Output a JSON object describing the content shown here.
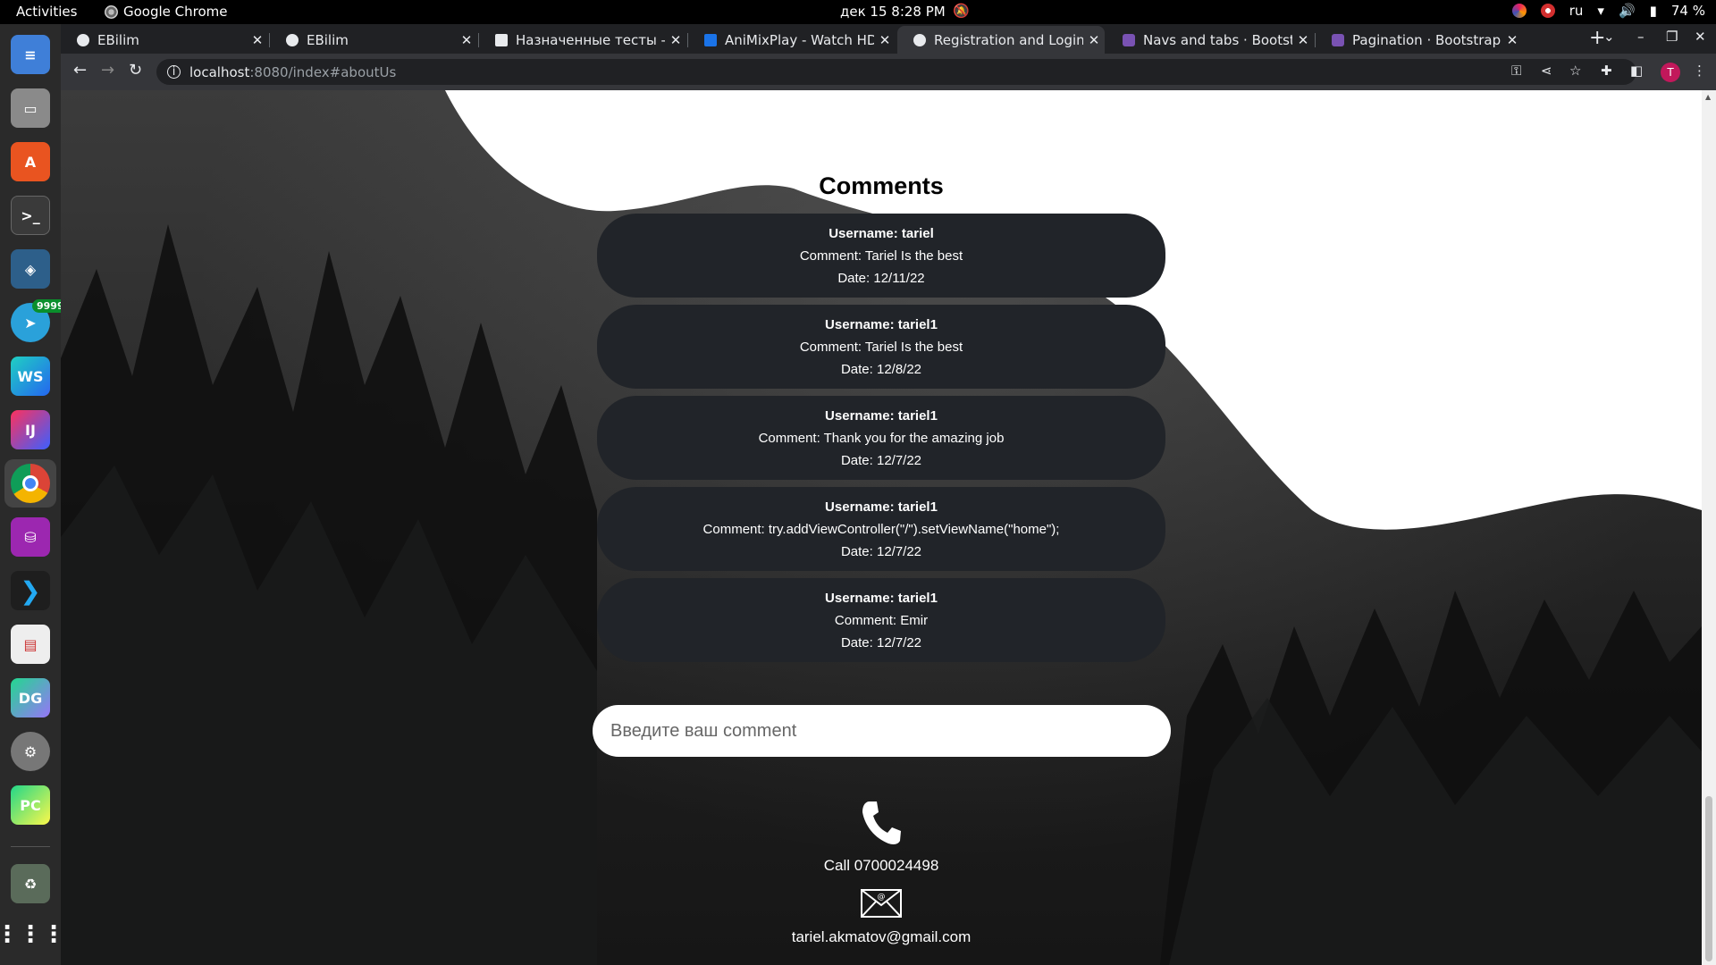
{
  "system_bar": {
    "activities": "Activities",
    "app_name": "Google Chrome",
    "clock": "дек 15   8:28 PM",
    "keyboard_layout": "ru",
    "battery": "74 %"
  },
  "dock": {
    "telegram_badge": "9999",
    "items": [
      "text-editor",
      "files",
      "app-center",
      "terminal",
      "mysql-workbench",
      "telegram",
      "webstorm",
      "intellij",
      "chrome",
      "database",
      "vscode",
      "document-viewer",
      "datagrip",
      "settings",
      "pycharm",
      "trash",
      "show-apps"
    ],
    "labels": {
      "webstorm": "WS",
      "intellij": "IJ",
      "datagrip": "DG",
      "pycharm": "PC"
    }
  },
  "browser": {
    "tabs": [
      {
        "title": "EBilim",
        "active": false
      },
      {
        "title": "EBilim",
        "active": false
      },
      {
        "title": "Назначенные тесты - Те",
        "active": false
      },
      {
        "title": "AniMixPlay - Watch HD A",
        "active": false
      },
      {
        "title": "Registration and Login S",
        "active": true
      },
      {
        "title": "Navs and tabs · Bootstra",
        "active": false
      },
      {
        "title": "Pagination · Bootstrap",
        "active": false
      }
    ],
    "url_host": "localhost",
    "url_path": ":8080/index#aboutUs",
    "profile_initial": "T"
  },
  "page": {
    "comments_title": "Comments",
    "comments": [
      {
        "username": "Username: tariel",
        "comment": "Comment: Tariel Is the best",
        "date": "Date: 12/11/22"
      },
      {
        "username": "Username: tariel1",
        "comment": "Comment: Tariel Is the best",
        "date": "Date: 12/8/22"
      },
      {
        "username": "Username: tariel1",
        "comment": "Comment: Thank you for the amazing job",
        "date": "Date: 12/7/22"
      },
      {
        "username": "Username: tariel1",
        "comment": "Comment: try.addViewController(\"/\").setViewName(\"home\");",
        "date": "Date: 12/7/22"
      },
      {
        "username": "Username: tariel1",
        "comment": "Comment: Emir",
        "date": "Date: 12/7/22"
      }
    ],
    "comment_input_placeholder": "Введите ваш comment",
    "phone_text": "Call 0700024498",
    "email_text": "tariel.akmatov@gmail.com"
  }
}
